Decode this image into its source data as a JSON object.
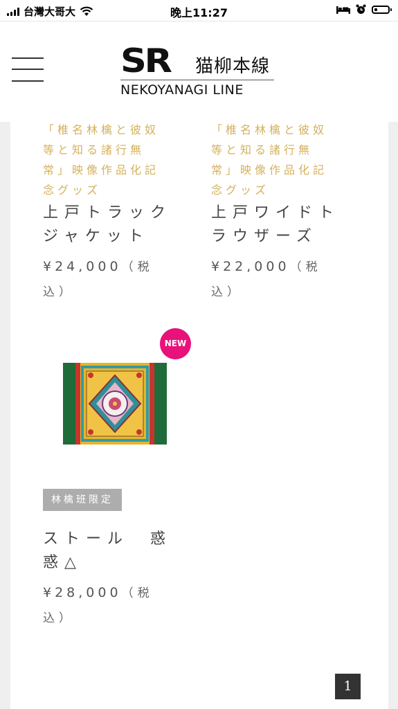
{
  "status_bar": {
    "carrier": "台灣大哥大",
    "time": "晚上11:27"
  },
  "header": {
    "logo_mark": "SR",
    "logo_japanese": "猫柳本線",
    "logo_subtitle": "NEKOYANAGI LINE"
  },
  "products": [
    {
      "tag_lines": [
        "「椎名林檎と彼奴",
        "等と知る諸行無",
        "常」映像作品化記",
        "念グッズ"
      ],
      "name_lines": [
        "上戸トラック",
        "ジャケット"
      ],
      "price": "¥24,000",
      "tax_open": "（税",
      "tax_close": "込）"
    },
    {
      "tag_lines": [
        "「椎名林檎と彼奴",
        "等と知る諸行無",
        "常」映像作品化記",
        "念グッズ"
      ],
      "name_lines": [
        "上戸ワイドト",
        "ラウザーズ"
      ],
      "price": "¥22,000",
      "tax_open": "（税",
      "tax_close": "込）"
    },
    {
      "badge": "NEW",
      "limited_label": "林檎班限定",
      "name_lines": [
        "ストール　惑",
        "惑△"
      ],
      "price": "¥28,000",
      "tax_open": "（税",
      "tax_close": "込）"
    }
  ],
  "pagination": {
    "current_page": "1"
  },
  "colors": {
    "tag_gold": "#d4b15e",
    "new_badge": "#e8127a",
    "limited_badge": "#adadad",
    "page_button": "#333333"
  }
}
